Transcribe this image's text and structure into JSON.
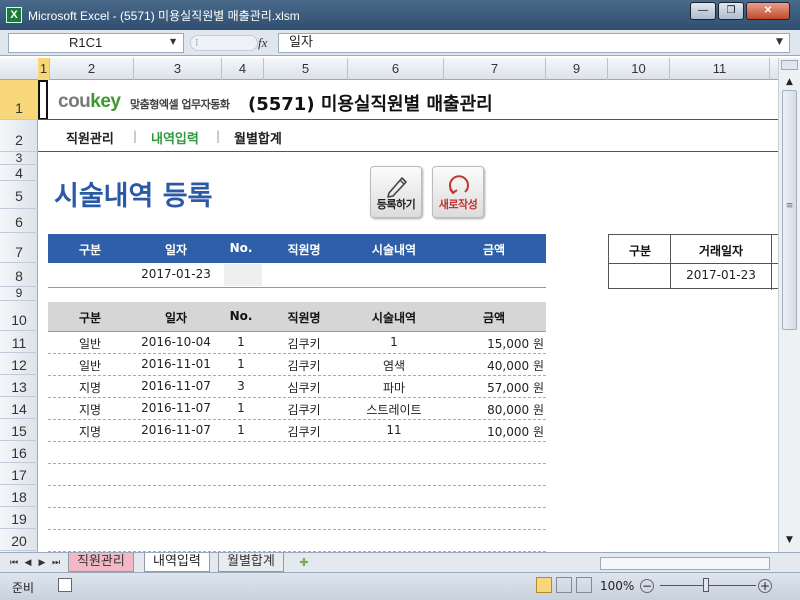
{
  "window": {
    "title": "Microsoft Excel - (5571) 미용실직원별 매출관리.xlsm",
    "app_icon": "X",
    "min": "—",
    "restore": "❐",
    "close": "✕"
  },
  "formula_bar": {
    "name_box": "R1C1",
    "fx_label": "fx",
    "value": "일자"
  },
  "columns": [
    "1",
    "2",
    "3",
    "4",
    "5",
    "6",
    "7",
    "9",
    "10",
    "11"
  ],
  "rows": [
    "1",
    "2",
    "3",
    "4",
    "5",
    "6",
    "7",
    "8",
    "9",
    "10",
    "11",
    "12",
    "13",
    "14",
    "15",
    "16",
    "17",
    "18",
    "19",
    "20"
  ],
  "brand": {
    "logo_cou": "cou",
    "logo_key": "key",
    "tagline": "맞춤형엑셀 업무자동화",
    "title": "(5571) 미용실직원별 매출관리"
  },
  "nav": {
    "items": [
      "직원관리",
      "내역입력",
      "월별합계"
    ],
    "separator": "|",
    "active_index": 1
  },
  "page_title": "시술내역 등록",
  "buttons": {
    "register": "등록하기",
    "new": "새로작성"
  },
  "entry_form": {
    "headers": [
      "구분",
      "일자",
      "No.",
      "직원명",
      "시술내역",
      "금액"
    ],
    "row": [
      "",
      "2017-01-23",
      "",
      "",
      "",
      ""
    ]
  },
  "list_table": {
    "headers": [
      "구분",
      "일자",
      "No.",
      "직원명",
      "시술내역",
      "금액"
    ],
    "rows": [
      [
        "일반",
        "2016-10-04",
        "1",
        "김쿠키",
        "1",
        "15,000 원"
      ],
      [
        "일반",
        "2016-11-01",
        "1",
        "김쿠키",
        "염색",
        "40,000 원"
      ],
      [
        "지명",
        "2016-11-07",
        "3",
        "심쿠키",
        "파마",
        "57,000 원"
      ],
      [
        "지명",
        "2016-11-07",
        "1",
        "김쿠키",
        "스트레이트",
        "80,000 원"
      ],
      [
        "지명",
        "2016-11-07",
        "1",
        "김쿠키",
        "11",
        "10,000 원"
      ]
    ]
  },
  "side_table": {
    "headers": [
      "구분",
      "거래일자"
    ],
    "row": [
      "",
      "2017-01-23"
    ]
  },
  "sheet_tabs": [
    "직원관리",
    "내역입력",
    "월별합계"
  ],
  "status": {
    "ready": "준비",
    "zoom": "100%"
  },
  "colors": {
    "accent_blue": "#2e5fa8",
    "title_blue": "#2a5aa6",
    "nav_active": "#2e9a3e",
    "logo_green": "#3c9a2c",
    "logo_gray": "#7a7a7a"
  }
}
